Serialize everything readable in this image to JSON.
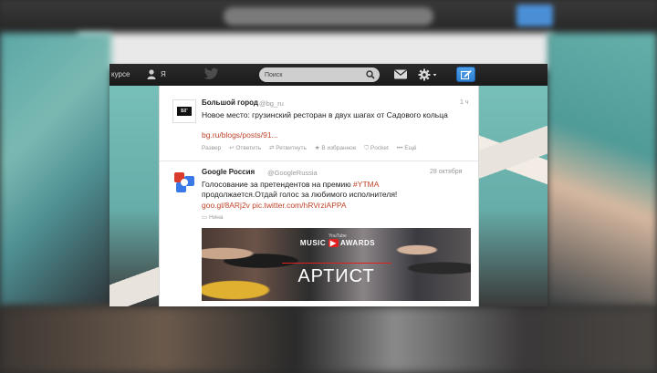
{
  "topbar": {
    "nav_left": "курсе",
    "nav_me": "Я",
    "search_placeholder": "Поиск"
  },
  "tweets": [
    {
      "name": "Большой город",
      "handle": "@bg_ru",
      "time": "1 ч",
      "avatar_text": "БГ",
      "text": "Новое место: грузинский ресторан в двух шагах от Садового кольца",
      "link": "bg.ru/blogs/posts/91...",
      "actions": [
        "Развер",
        "Ответить",
        "Ретвитнуть",
        "В избранное",
        "Pocket",
        "Ещё"
      ]
    },
    {
      "name": "Google Россия",
      "handle": "@GoogleRussia",
      "time": "28 октября",
      "text_line1_prefix": "Голосование за претендентов на премию ",
      "hashtag": "#YTMA",
      "text_line2": "продолжается.Отдай голос за любимого исполнителя!",
      "link": "goo.gl/8ARj2v pic.twitter.com/hRVrziAPPA",
      "region": "Нина",
      "media": {
        "small_text": "YouTube",
        "logo_text_1": "MUSIC",
        "logo_text_2": "AWARDS",
        "title": "АРТИСТ"
      }
    }
  ],
  "colors": {
    "accent_link": "#c0442a",
    "compose_button": "#3a8ad8",
    "topbar": "#222222"
  }
}
